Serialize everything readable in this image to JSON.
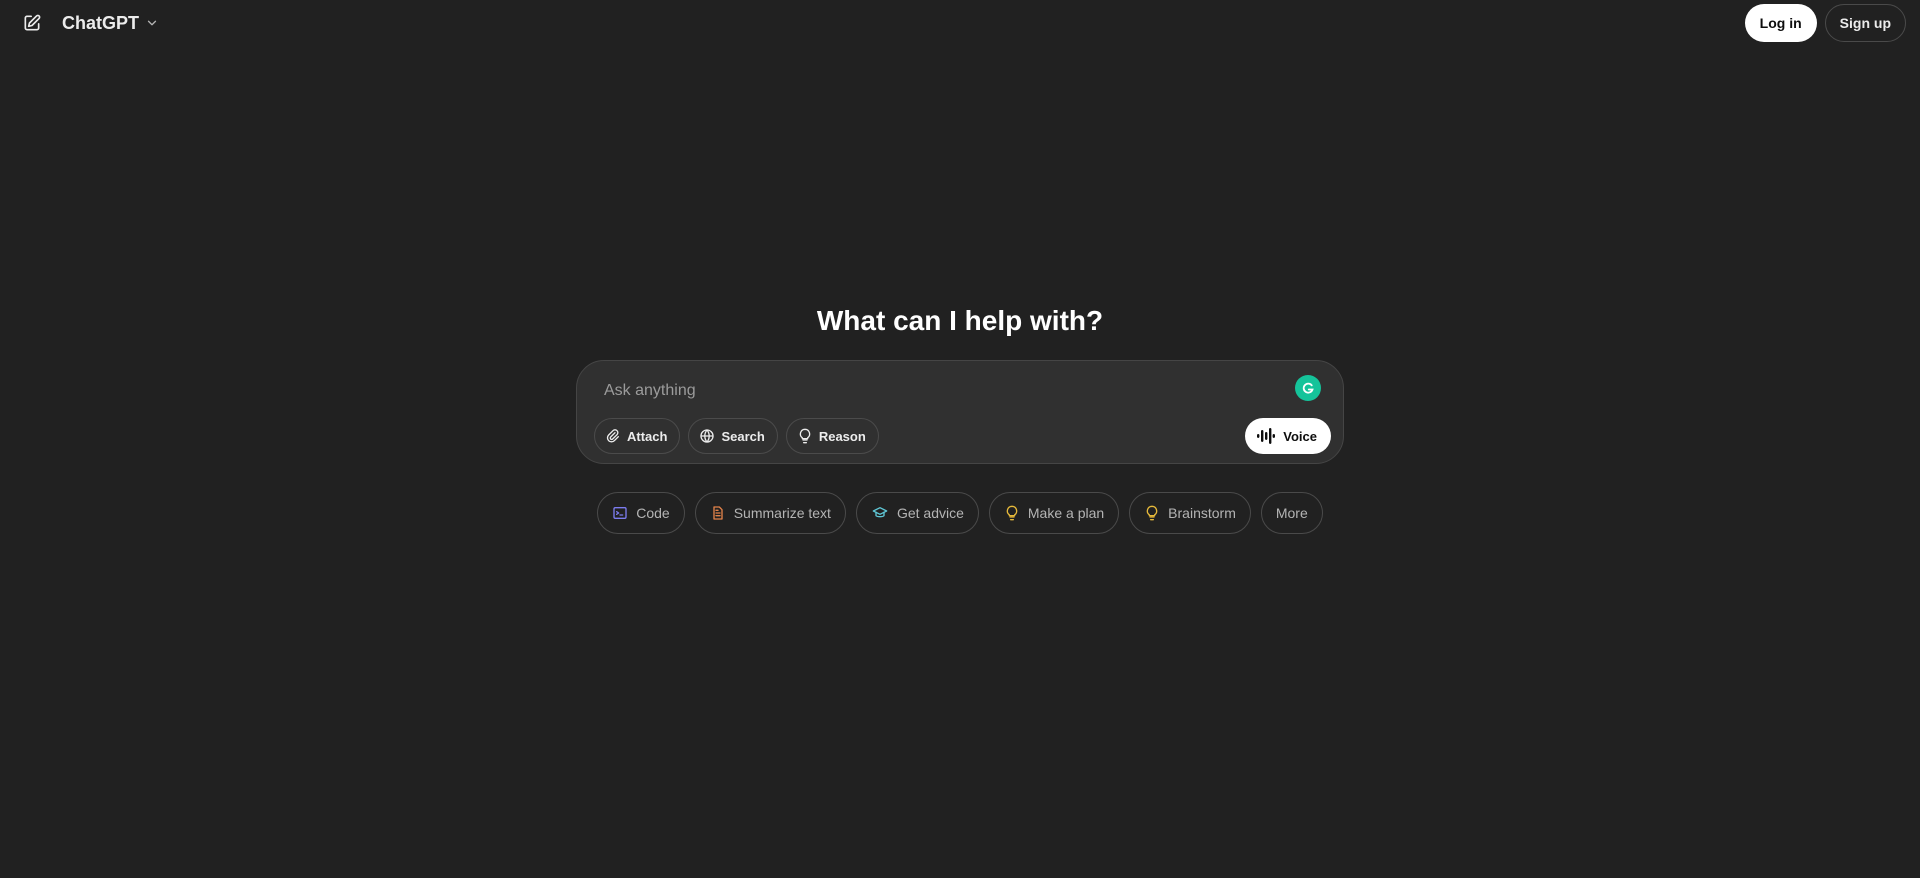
{
  "header": {
    "model_name": "ChatGPT",
    "login_label": "Log in",
    "signup_label": "Sign up"
  },
  "main": {
    "headline": "What can I help with?",
    "composer": {
      "placeholder": "Ask anything",
      "tools": [
        {
          "label": "Attach",
          "icon": "paperclip-icon"
        },
        {
          "label": "Search",
          "icon": "globe-icon"
        },
        {
          "label": "Reason",
          "icon": "lightbulb-icon"
        }
      ],
      "voice_label": "Voice"
    },
    "suggestions": [
      {
        "label": "Code",
        "icon": "terminal-icon",
        "color": "#7c7cf0"
      },
      {
        "label": "Summarize text",
        "icon": "document-icon",
        "color": "#e2824a"
      },
      {
        "label": "Get advice",
        "icon": "graduation-cap-icon",
        "color": "#5fc7d6"
      },
      {
        "label": "Make a plan",
        "icon": "lightbulb-icon",
        "color": "#e6b93a"
      },
      {
        "label": "Brainstorm",
        "icon": "lightbulb-icon",
        "color": "#e6b93a"
      },
      {
        "label": "More",
        "icon": "",
        "color": ""
      }
    ]
  },
  "colors": {
    "background": "#212121",
    "composer_bg": "#303030",
    "grammarly": "#15c39a"
  }
}
